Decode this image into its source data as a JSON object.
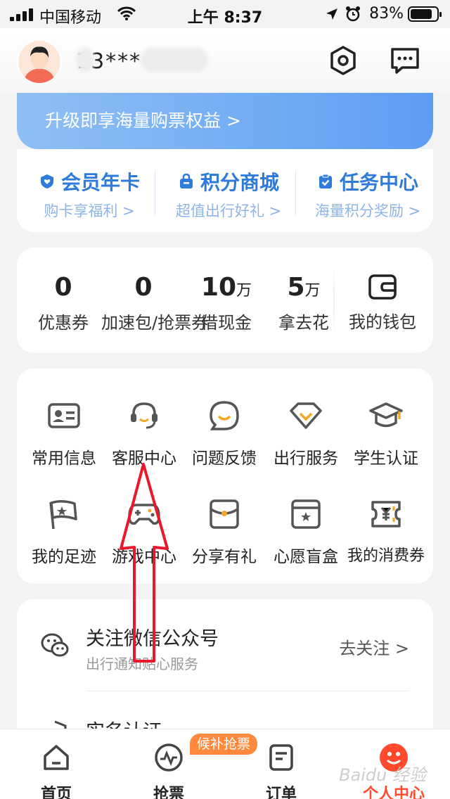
{
  "status_bar": {
    "carrier": "中国移动",
    "time": "上午 8:37",
    "battery": "83%"
  },
  "header": {
    "username": "13***"
  },
  "vip_banner": {
    "text": "升级即享海量购票权益 >"
  },
  "vip_items": [
    {
      "title": "会员年卡",
      "sub": "购卡享福利 >",
      "icon": "heart-shield-icon"
    },
    {
      "title": "积分商城",
      "sub": "超值出行好礼 >",
      "icon": "shopping-bag-icon"
    },
    {
      "title": "任务中心",
      "sub": "海量积分奖励 >",
      "icon": "clipboard-check-icon"
    }
  ],
  "stats": [
    {
      "num": "0",
      "unit": "",
      "label": "优惠券"
    },
    {
      "num": "0",
      "unit": "",
      "label": "加速包/抢票券"
    },
    {
      "num": "10",
      "unit": "万",
      "label": "借现金"
    },
    {
      "num": "5",
      "unit": "万",
      "label": "拿去花"
    }
  ],
  "wallet": {
    "label": "我的钱包",
    "icon": "wallet-icon"
  },
  "services": [
    {
      "label": "常用信息",
      "icon": "id-card-icon"
    },
    {
      "label": "客服中心",
      "icon": "headset-icon"
    },
    {
      "label": "问题反馈",
      "icon": "smile-chat-icon"
    },
    {
      "label": "出行服务",
      "icon": "diamond-icon"
    },
    {
      "label": "学生认证",
      "icon": "graduation-cap-icon"
    },
    {
      "label": "我的足迹",
      "icon": "flag-icon"
    },
    {
      "label": "游戏中心",
      "icon": "gamepad-icon"
    },
    {
      "label": "分享有礼",
      "icon": "envelope-icon"
    },
    {
      "label": "心愿盲盒",
      "icon": "gift-box-icon"
    },
    {
      "label": "我的消费券",
      "icon": "ticket-icon"
    }
  ],
  "list": {
    "wechat_title": "关注微信公众号",
    "wechat_sub": "出行通知贴心服务",
    "wechat_action": "去关注 >",
    "realname_title": "实名认证"
  },
  "tabbar": {
    "tabs": [
      {
        "label": "首页",
        "icon": "home-icon"
      },
      {
        "label": "抢票",
        "icon": "pulse-icon"
      },
      {
        "label": "订单",
        "icon": "order-list-icon"
      },
      {
        "label": "个人中心",
        "icon": "user-center-icon"
      }
    ],
    "promo_badge": "候补抢票"
  },
  "watermark": "Baidu 经验",
  "colors": {
    "accent_blue": "#2f7bdb",
    "accent_orange": "#ff4a2e",
    "annotation_red": "#e8192c"
  }
}
